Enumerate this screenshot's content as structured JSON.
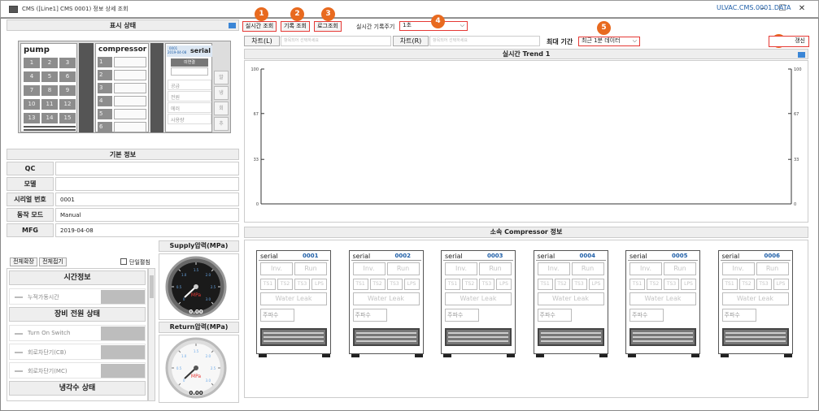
{
  "window": {
    "title": "CMS ([Line1] CMS 0001) 정보 상세 조회",
    "brand": "ULVAC.CMS.0001.DATA",
    "minimize": "–",
    "maximize": "☐",
    "close": "✕"
  },
  "left": {
    "status_title": "표시 상태",
    "pump_title": "pump",
    "pump_cells": [
      "1",
      "2",
      "3",
      "4",
      "5",
      "6",
      "7",
      "8",
      "9",
      "10",
      "11",
      "12",
      "13",
      "14",
      "15"
    ],
    "compressor_title": "compressor",
    "compressor_rows": [
      "1",
      "2",
      "3",
      "4",
      "5",
      "6"
    ],
    "serial_title": "serial",
    "serial_no": "0001",
    "serial_date": "2019-04-08",
    "serial_connected": "미연결",
    "serial_rows": [
      "공급",
      "전원",
      "에러",
      "사용량"
    ],
    "side_btns": [
      "발",
      "냉",
      "회",
      "추"
    ],
    "basic_title": "기본 정보",
    "info": [
      {
        "label": "QC",
        "value": ""
      },
      {
        "label": "모델",
        "value": ""
      },
      {
        "label": "시리얼 번호",
        "value": "0001"
      },
      {
        "label": "동작 모드",
        "value": "Manual"
      },
      {
        "label": "MFG",
        "value": "2019-04-08"
      }
    ],
    "expand_all": "전체확장",
    "collapse_all": "전체접기",
    "single_expand": "단일펼침",
    "sections": [
      {
        "title": "시간정보",
        "items": [
          "누적가동시간"
        ]
      },
      {
        "title": "장비 전원 상태",
        "items": [
          "Turn On Switch",
          "회로차단기(CB)",
          "회로차단기(MC)"
        ]
      },
      {
        "title": "냉각수 상태",
        "items": []
      }
    ],
    "supply_title": "Supply압력(MPa)",
    "return_title": "Return압력(MPa)",
    "gauge_unit": "MPa",
    "gauge_value": "0.00",
    "gauge_ticks": [
      "0",
      "0.5",
      "1.0",
      "1.5",
      "2.0",
      "2.5",
      "3.0"
    ]
  },
  "toolbar": {
    "realtime": "실시간 조회",
    "history": "기록 조회",
    "log": "로그조회",
    "interval_label": "실시간 기록주기",
    "interval_value": "1초",
    "chart_l": "차트(L)",
    "chart_r": "차트(R)",
    "chart_placeholder": "항목되어 선택하세요",
    "max_period_label": "최대 기간",
    "max_period_value": "최근 1분 데이터",
    "refresh": "갱신",
    "markers": [
      "1",
      "2",
      "3",
      "4",
      "5",
      "6"
    ]
  },
  "chart_data": {
    "type": "line",
    "title": "실시간 Trend 1",
    "xlabel": "",
    "ylabel": "",
    "ylim": [
      0,
      100
    ],
    "yticks": [
      0,
      33,
      67,
      100
    ],
    "series": []
  },
  "comp_section": {
    "title": "소속 Compressor 정보",
    "label_serial": "serial",
    "units": [
      "0001",
      "0002",
      "0003",
      "0004",
      "0005",
      "0006"
    ],
    "inv": "Inv.",
    "run": "Run",
    "ts": [
      "TS1",
      "TS2",
      "TS3",
      "LPS"
    ],
    "water": "Water Leak",
    "freq": "주파수"
  },
  "colors": {
    "accent": "#1f5fa8",
    "marker": "#e86a1f",
    "highlight": "#e53935",
    "cell": "#8d8d8d"
  }
}
